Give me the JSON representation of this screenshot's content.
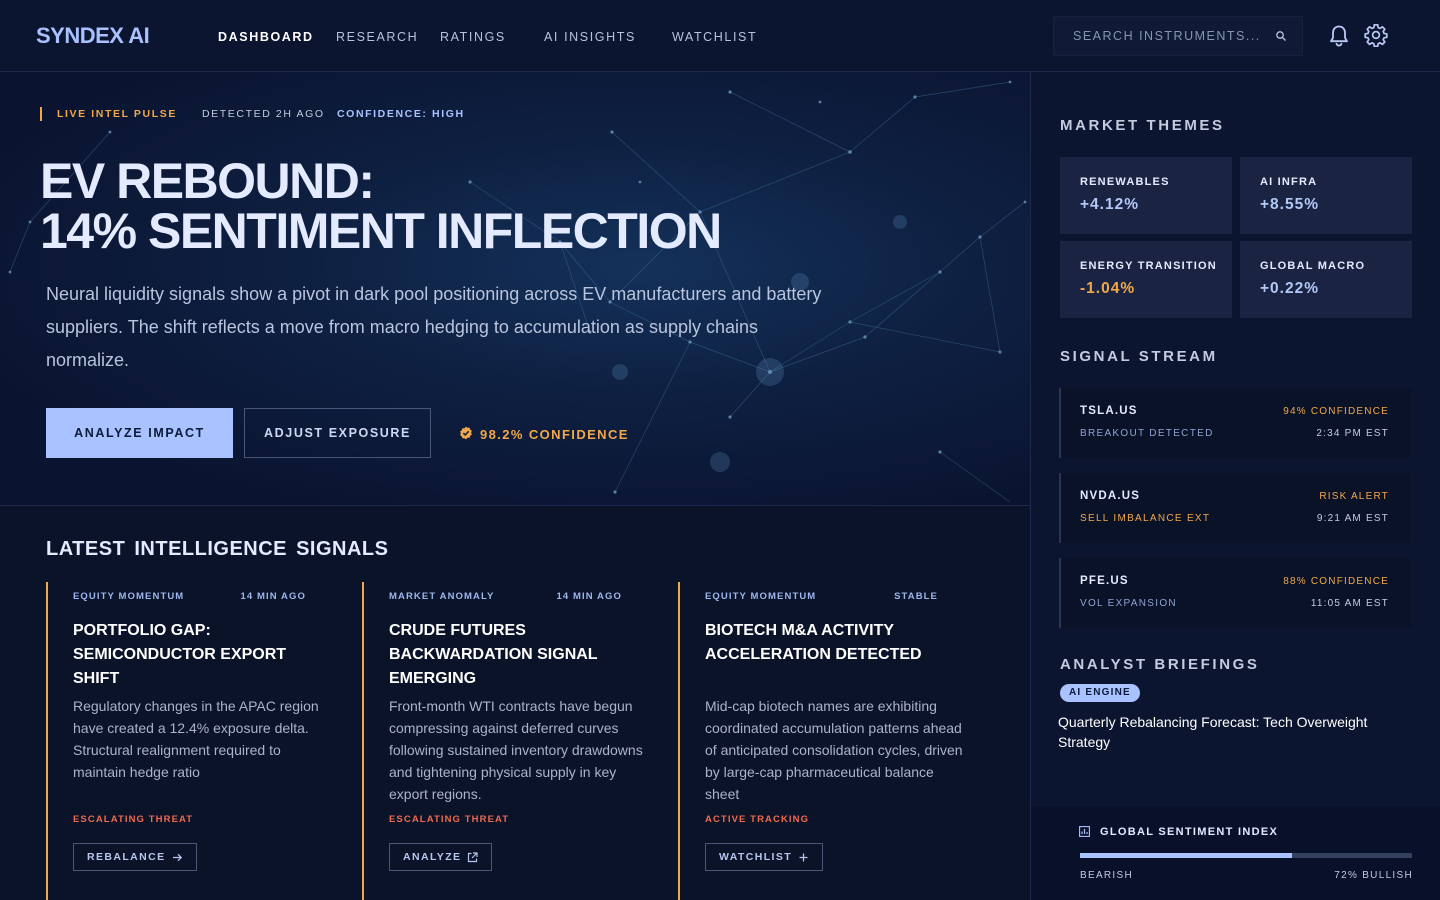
{
  "brand": {
    "logo": "SYNDEX AI"
  },
  "nav": {
    "items": [
      {
        "label": "DASHBOARD",
        "active": true
      },
      {
        "label": "RESEARCH",
        "active": false
      },
      {
        "label": "RATINGS",
        "active": false
      },
      {
        "label": "AI INSIGHTS",
        "active": false
      },
      {
        "label": "WATCHLIST",
        "active": false
      }
    ],
    "search_placeholder": "SEARCH INSTRUMENTS...",
    "icons": [
      "search-icon",
      "bell-icon",
      "gear-icon"
    ]
  },
  "hero": {
    "tags": {
      "pulse": "LIVE INTEL PULSE",
      "detected": "DETECTED 2H AGO",
      "confidence": "CONFIDENCE: HIGH"
    },
    "title_line1": "EV REBOUND:",
    "title_line2": "14% SENTIMENT INFLECTION",
    "description": "Neural liquidity signals show a pivot in dark pool positioning across EV manufacturers and battery suppliers. The shift reflects a move from macro hedging to accumulation as supply chains normalize.",
    "primary_button": "ANALYZE IMPACT",
    "secondary_button": "ADJUST EXPOSURE",
    "confidence_badge": "98.2% CONFIDENCE"
  },
  "signals": {
    "title": "LATEST INTELLIGENCE SIGNALS",
    "cards": [
      {
        "category": "EQUITY MOMENTUM",
        "time": "14 MIN AGO",
        "title": "PORTFOLIO GAP: SEMICONDUCTOR EXPORT SHIFT",
        "body": "Regulatory changes in the APAC region have created a 12.4% exposure delta. Structural realignment required to maintain hedge ratio",
        "status": "ESCALATING THREAT",
        "action": "REBALANCE",
        "action_icon": "arrow-right-icon"
      },
      {
        "category": "MARKET ANOMALY",
        "time": "14 MIN AGO",
        "title": "CRUDE FUTURES BACKWARDATION SIGNAL EMERGING",
        "body": "Front-month WTI contracts have begun compressing against deferred curves following sustained inventory drawdowns and tightening physical supply in key export regions.",
        "status": "ESCALATING THREAT",
        "action": "ANALYZE",
        "action_icon": "external-link-icon"
      },
      {
        "category": "EQUITY MOMENTUM",
        "time": "STABLE",
        "title": "BIOTECH M&A ACTIVITY ACCELERATION DETECTED",
        "body": "Mid-cap biotech names are exhibiting coordinated accumulation patterns ahead of anticipated consolidation cycles, driven by large-cap pharmaceutical balance sheet",
        "status": "ACTIVE TRACKING",
        "action": "WATCHLIST",
        "action_icon": "plus-icon"
      }
    ]
  },
  "sidebar": {
    "themes_title": "MARKET THEMES",
    "themes": [
      {
        "name": "RENEWABLES",
        "value": "+4.12%",
        "color": "#b2c8f6"
      },
      {
        "name": "AI INFRA",
        "value": "+8.55%",
        "color": "#b2c8f6"
      },
      {
        "name": "ENERGY TRANSITION",
        "value": "-1.04%",
        "color": "#f2a84a"
      },
      {
        "name": "GLOBAL MACRO",
        "value": "+0.22%",
        "color": "#b2c8f6"
      }
    ],
    "stream_title": "SIGNAL STREAM",
    "stream": [
      {
        "ticker": "TSLA.US",
        "label": "BREAKOUT DETECTED",
        "confidence": "94% CONFIDENCE",
        "time": "2:34 PM EST",
        "label_color": "#8ea3d4",
        "border_color": "#2a3656"
      },
      {
        "ticker": "NVDA.US",
        "label": "SELL IMBALANCE EXT",
        "confidence": "RISK ALERT",
        "time": "9:21 AM EST",
        "label_color": "#f2a84a",
        "border_color": "#2a3656"
      },
      {
        "ticker": "PFE.US",
        "label": "VOL EXPANSION",
        "confidence": "88% CONFIDENCE",
        "time": "11:05 AM EST",
        "label_color": "#8ea3d4",
        "border_color": "#2a3656"
      }
    ],
    "briefings_title": "ANALYST BRIEFINGS",
    "briefing_badge": "AI ENGINE",
    "briefing_text": "Quarterly Rebalancing Forecast: Tech Overweight Strategy",
    "gsi": {
      "title": "GLOBAL SENTIMENT INDEX",
      "bullish_fraction": 0.64,
      "left_label": "BEARISH",
      "right_label": "72% BULLISH"
    }
  },
  "colors": {
    "accent": "#a8c3ff",
    "warning": "#f2a84a",
    "danger": "#ee6a50",
    "background": "#0b1328"
  }
}
